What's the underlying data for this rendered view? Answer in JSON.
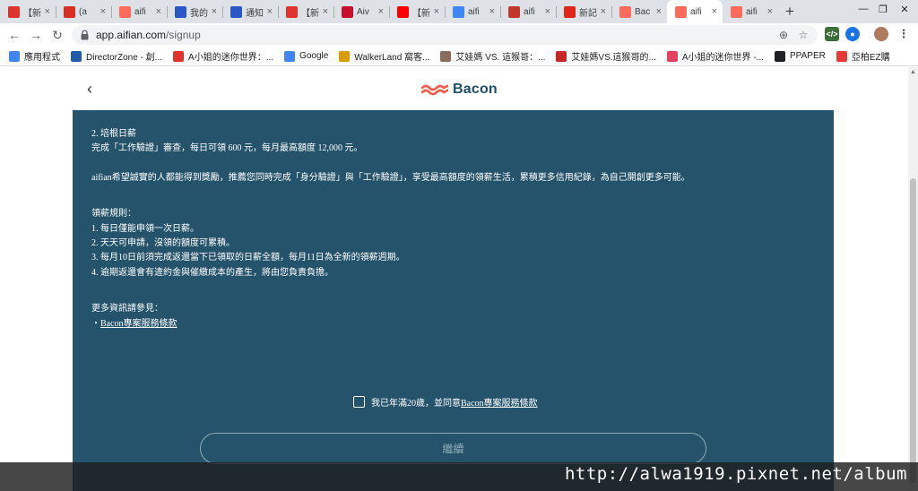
{
  "tabs": [
    {
      "title": "【新",
      "icon": "pixnet-icon",
      "color": "#e0332e"
    },
    {
      "title": "(a",
      "icon": "gmail-icon",
      "color": "#d93025"
    },
    {
      "title": "aifi",
      "icon": "aifian-icon",
      "color": "#ff6b5b"
    },
    {
      "title": "我的",
      "icon": "chat-icon",
      "color": "#2a56c6"
    },
    {
      "title": "通知",
      "icon": "chat-icon",
      "color": "#2a56c6"
    },
    {
      "title": "【新",
      "icon": "pixnet-icon",
      "color": "#e0332e"
    },
    {
      "title": "Aiv",
      "icon": "walkerland-icon",
      "color": "#c8102e"
    },
    {
      "title": "【新",
      "icon": "youtube-icon",
      "color": "#ff0000"
    },
    {
      "title": "aifi",
      "icon": "google-icon",
      "color": "#4285f4"
    },
    {
      "title": "aifi",
      "icon": "camera-icon",
      "color": "#c0392b"
    },
    {
      "title": "新記",
      "icon": "news-icon",
      "color": "#e1251b"
    },
    {
      "title": "Bac",
      "icon": "aifian-icon",
      "color": "#ff6b5b"
    },
    {
      "title": "aifi",
      "icon": "aifian-icon",
      "color": "#ff6b5b",
      "active": true
    },
    {
      "title": "aifi",
      "icon": "aifian-icon",
      "color": "#ff6b5b"
    }
  ],
  "address": {
    "host": "app.aifian.com",
    "path": "/signup"
  },
  "bookmarks": [
    {
      "label": "應用程式",
      "icon": "apps-icon",
      "color": "#4285f4"
    },
    {
      "label": "DirectorZone - 創...",
      "icon": "dz-icon",
      "color": "#1f5ba8"
    },
    {
      "label": "A小姐的迷你世界：...",
      "icon": "pixnet-icon",
      "color": "#e0332e"
    },
    {
      "label": "Google",
      "icon": "google-icon",
      "color": "#4285f4"
    },
    {
      "label": "WalkerLand 窩客...",
      "icon": "walkerland-icon",
      "color": "#d89b00"
    },
    {
      "label": "艾娃媽 VS. 這猴哥：...",
      "icon": "avatar-icon",
      "color": "#8a6d5a"
    },
    {
      "label": "艾娃媽VS.這猴哥的...",
      "icon": "ava-icon",
      "color": "#c62828"
    },
    {
      "label": "A小姐的迷你世界 -...",
      "icon": "ig-icon",
      "color": "#e4405f"
    },
    {
      "label": "PPAPER",
      "icon": "pp-icon",
      "color": "#202124"
    },
    {
      "label": "亞柏EZ購",
      "icon": "ap-icon",
      "color": "#e53935"
    }
  ],
  "brand": {
    "name": "Bacon",
    "accent": "#f05a48",
    "panel_color": "#24536b"
  },
  "terms": {
    "section2_title": "2. 培根日薪",
    "section2_body": "完成「工作驗證」審查，每日可領 600 元，每月最高額度 12,000 元。",
    "encourage": "aifian希望誠實的人都能得到獎勵，推薦您同時完成「身分驗證」與「工作驗證」，享受最高額度的領薪生活，累積更多信用紀錄，為自己開創更多可能。",
    "rules_title": "領薪規則：",
    "rules": [
      "1. 每日僅能申領一次日薪。",
      "2. 天天可申請，沒領的額度可累積。",
      "3. 每月10日前須完成返還當下已領取的日薪全額，每月11日為全新的領薪週期。",
      "4. 逾期返還會有違約金與催繳成本的產生，將由您負責負擔。"
    ],
    "more_info": "更多資訊請參見：",
    "more_link_bullet": "・",
    "more_link": "Bacon專案服務條款"
  },
  "agree": {
    "prefix": "我已年滿20歲，並同意",
    "link": "Bacon專案服務條款"
  },
  "continue_label": "繼續",
  "watermark": "http://alwa1919.pixnet.net/album"
}
